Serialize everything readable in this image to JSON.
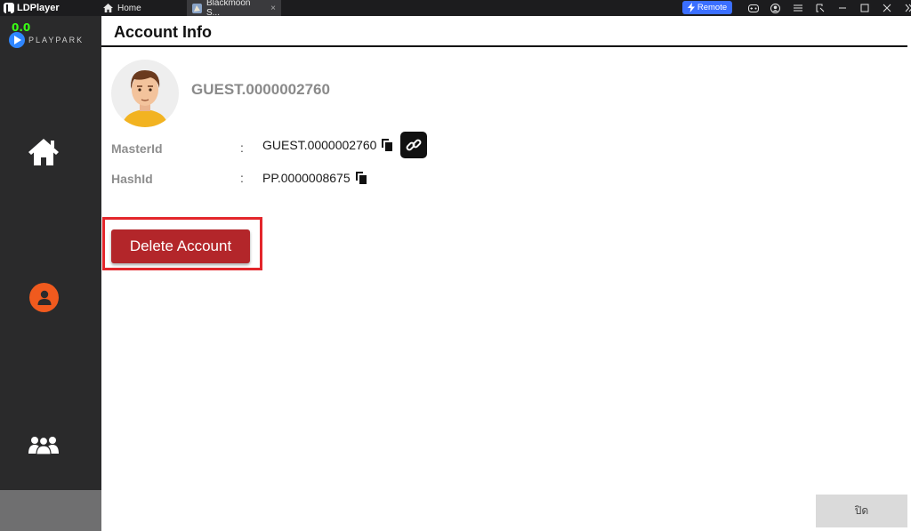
{
  "titlebar": {
    "app_name": "LDPlayer",
    "tabs": [
      {
        "label": "Home",
        "icon": "home-icon"
      },
      {
        "label": "Blackmoon S...",
        "icon": "game-icon",
        "close": "×"
      }
    ],
    "remote_label": "Remote",
    "window_icons": [
      "gamepad-icon",
      "account-icon",
      "menu-icon",
      "restore-icon",
      "minimize-icon",
      "maximize-icon",
      "close-icon",
      "expand-icon"
    ]
  },
  "sidebar": {
    "fps": "0.0",
    "logo_text": "PLAYPARK",
    "items": [
      {
        "name": "home",
        "icon": "home-icon"
      },
      {
        "name": "profile",
        "icon": "user-icon",
        "active_color": "#f05a1e"
      },
      {
        "name": "community",
        "icon": "group-icon"
      }
    ]
  },
  "header": {
    "title": "Account Info"
  },
  "account": {
    "username": "GUEST.0000002760",
    "rows": [
      {
        "label": "MasterId",
        "colon": ":",
        "value": "GUEST.0000002760"
      },
      {
        "label": "HashId",
        "colon": ":",
        "value": "PP.0000008675"
      }
    ],
    "delete_label": "Delete Account"
  },
  "footer": {
    "close_label": "ปิด"
  },
  "colors": {
    "danger": "#b3262a",
    "highlight": "#e3262b",
    "accent_remote": "#3b6fff",
    "sidebar": "#2a2a2b"
  }
}
